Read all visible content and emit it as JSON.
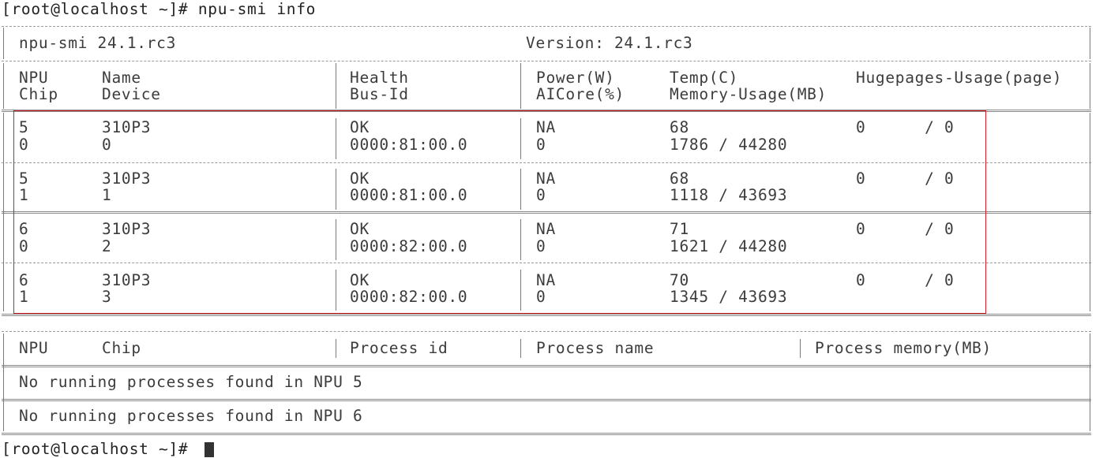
{
  "prompt": "[root@localhost ~]# ",
  "command": "npu-smi info",
  "tool": {
    "name": "npu-smi 24.1.rc3",
    "version": "Version: 24.1.rc3"
  },
  "headers": {
    "npu": "NPU",
    "chip": "Chip",
    "name": "Name",
    "device": "Device",
    "health": "Health",
    "bus_id": "Bus-Id",
    "power": "Power(W)",
    "aicore": "AICore(%)",
    "temp": "Temp(C)",
    "memory_usage": "Memory-Usage(MB)",
    "hugepages": "Hugepages-Usage(page)"
  },
  "devices": [
    {
      "npu": "5",
      "name": "310P3",
      "health": "OK",
      "power": "NA",
      "temp": "68",
      "hugepages": "0      / 0",
      "chip": "0",
      "device": "0",
      "bus_id": "0000:81:00.0",
      "aicore": "0",
      "memory": "1786 / 44280"
    },
    {
      "npu": "5",
      "name": "310P3",
      "health": "OK",
      "power": "NA",
      "temp": "68",
      "hugepages": "0      / 0",
      "chip": "1",
      "device": "1",
      "bus_id": "0000:81:00.0",
      "aicore": "0",
      "memory": "1118 / 43693"
    },
    {
      "npu": "6",
      "name": "310P3",
      "health": "OK",
      "power": "NA",
      "temp": "71",
      "hugepages": "0      / 0",
      "chip": "0",
      "device": "2",
      "bus_id": "0000:82:00.0",
      "aicore": "0",
      "memory": "1621 / 44280"
    },
    {
      "npu": "6",
      "name": "310P3",
      "health": "OK",
      "power": "NA",
      "temp": "70",
      "hugepages": "0      / 0",
      "chip": "1",
      "device": "3",
      "bus_id": "0000:82:00.0",
      "aicore": "0",
      "memory": "1345 / 43693"
    }
  ],
  "process_headers": {
    "npu": "NPU",
    "chip": "Chip",
    "process_id": "Process id",
    "process_name": "Process name",
    "process_memory": "Process memory(MB)"
  },
  "process_messages": [
    "No running processes found in NPU 5",
    "No running processes found in NPU 6"
  ],
  "highlight_color": "#d11f2a"
}
